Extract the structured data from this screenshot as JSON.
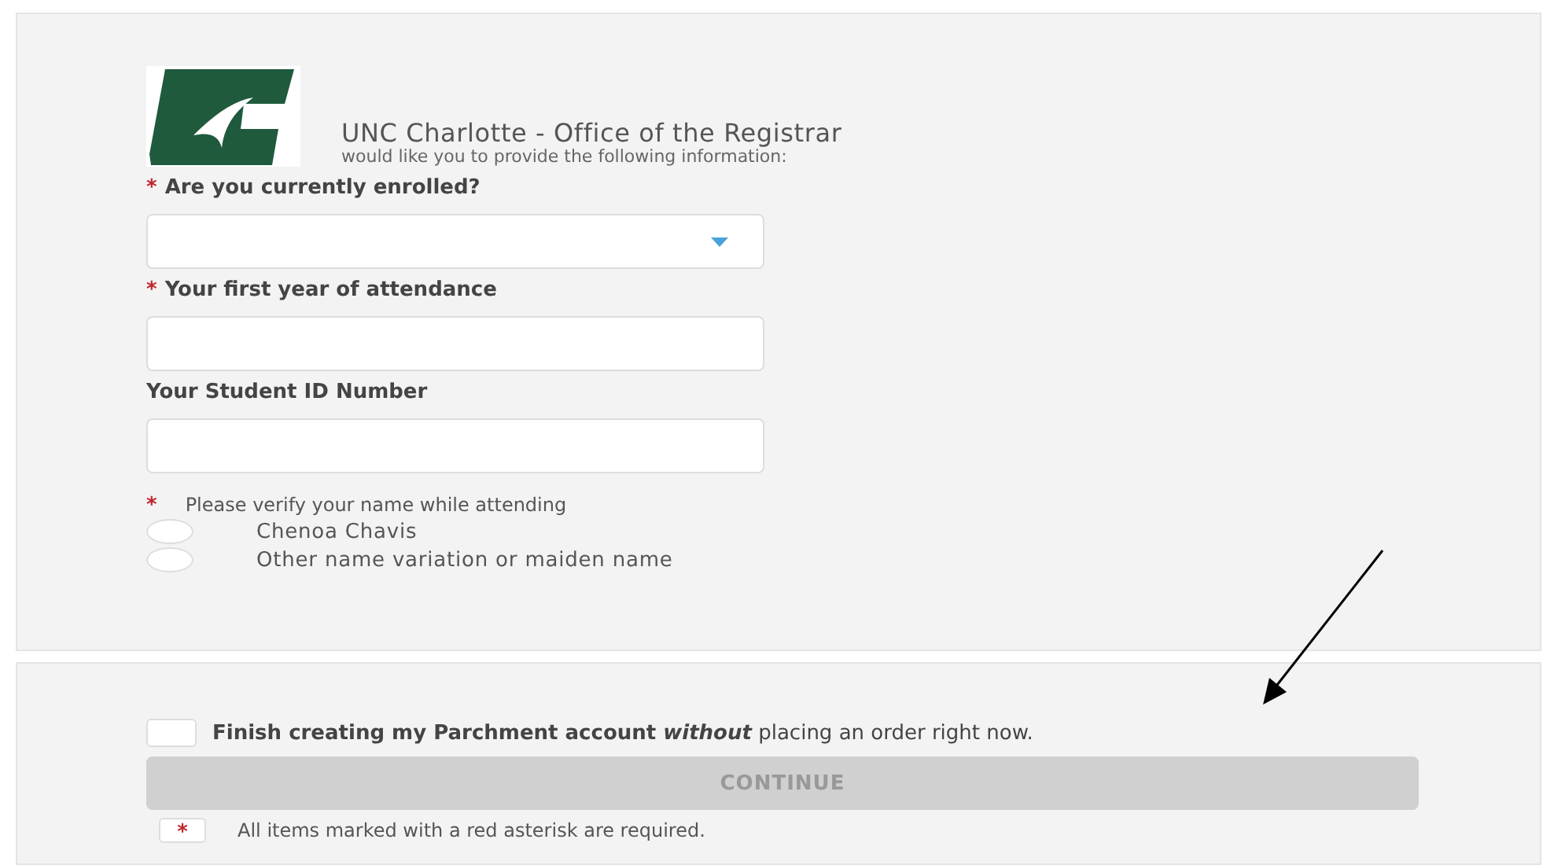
{
  "header": {
    "title": "UNC Charlotte - Office of the Registrar",
    "subtitle": "would like you to provide the following information:"
  },
  "fields": [
    {
      "kind": "select",
      "mark": "*",
      "label": "Are you currently enrolled?"
    },
    {
      "kind": "text",
      "mark": "*",
      "label": "Your first year of attendance"
    },
    {
      "kind": "text",
      "label": "Your Student ID Number"
    }
  ],
  "name_question": {
    "mark": "*",
    "label": "Please verify your name while attending",
    "options": [
      {
        "label": "Chenoa Chavis",
        "selected": false
      },
      {
        "label": "Other name variation or maiden name",
        "selected": false
      }
    ]
  },
  "account_option": {
    "bold_text": "Finish creating my Parchment account",
    "emphasis": "without",
    "rest": "placing an order right now.",
    "checked": false
  },
  "continue_button": {
    "label": "CONTINUE",
    "disabled": true
  },
  "required_note": {
    "mark": "*",
    "text": "All items marked with a red asterisk are required."
  }
}
